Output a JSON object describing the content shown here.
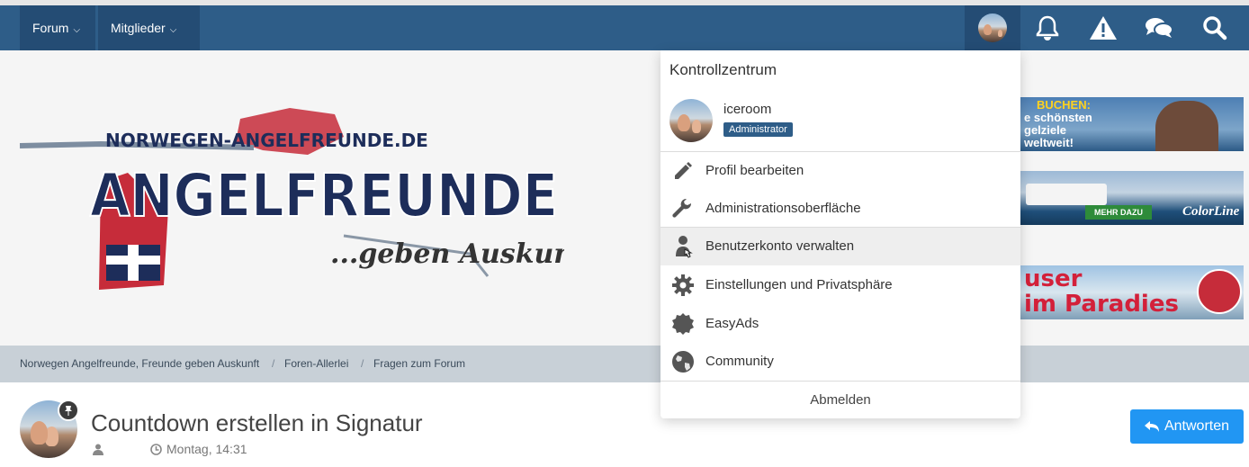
{
  "nav": {
    "forum_label": "Forum",
    "members_label": "Mitglieder"
  },
  "header": {
    "logo_site_text": "NORWEGEN-ANGELFREUNDE.DE",
    "logo_main_text": "ANGELFREUNDE",
    "logo_tagline": "...geben Auskunft",
    "ads": [
      {
        "line1": "BUCHEN:",
        "line2": "e schönsten",
        "line3": "gelziele",
        "line4": "weltweit!"
      },
      {
        "cta": "MEHR DAZU",
        "brand": "ColorLine"
      },
      {
        "line1": "user",
        "line2": "im Paradies"
      }
    ]
  },
  "breadcrumb": {
    "items": [
      "Norwegen Angelfreunde, Freunde geben Auskunft",
      "Foren-Allerlei",
      "Fragen zum Forum"
    ]
  },
  "thread": {
    "title": "Countdown erstellen in Signatur",
    "date": "Montag, 14:31",
    "reply_label": "Antworten"
  },
  "dropdown": {
    "title": "Kontrollzentrum",
    "username": "iceroom",
    "role": "Administrator",
    "items": [
      {
        "label": "Profil bearbeiten",
        "icon": "pencil-icon"
      },
      {
        "label": "Administrationsoberfläche",
        "icon": "wrench-icon"
      },
      {
        "label": "Benutzerkonto verwalten",
        "icon": "user-icon"
      },
      {
        "label": "Einstellungen und Privatsphäre",
        "icon": "gear-icon"
      },
      {
        "label": "EasyAds",
        "icon": "certificate-icon"
      },
      {
        "label": "Community",
        "icon": "globe-icon"
      }
    ],
    "logout_label": "Abmelden"
  },
  "colors": {
    "navbar": "#2e5d88",
    "navbar_active": "#244c74",
    "reply_button": "#2196f3",
    "badge": "#2e5d88"
  }
}
